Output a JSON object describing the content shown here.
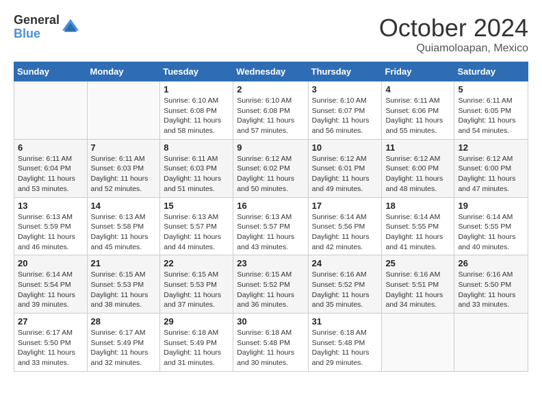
{
  "logo": {
    "general": "General",
    "blue": "Blue"
  },
  "header": {
    "month": "October 2024",
    "location": "Quiamoloapan, Mexico"
  },
  "weekdays": [
    "Sunday",
    "Monday",
    "Tuesday",
    "Wednesday",
    "Thursday",
    "Friday",
    "Saturday"
  ],
  "weeks": [
    [
      {
        "day": "",
        "info": ""
      },
      {
        "day": "",
        "info": ""
      },
      {
        "day": "1",
        "sunrise": "6:10 AM",
        "sunset": "6:08 PM",
        "daylight": "11 hours and 58 minutes."
      },
      {
        "day": "2",
        "sunrise": "6:10 AM",
        "sunset": "6:08 PM",
        "daylight": "11 hours and 57 minutes."
      },
      {
        "day": "3",
        "sunrise": "6:10 AM",
        "sunset": "6:07 PM",
        "daylight": "11 hours and 56 minutes."
      },
      {
        "day": "4",
        "sunrise": "6:11 AM",
        "sunset": "6:06 PM",
        "daylight": "11 hours and 55 minutes."
      },
      {
        "day": "5",
        "sunrise": "6:11 AM",
        "sunset": "6:05 PM",
        "daylight": "11 hours and 54 minutes."
      }
    ],
    [
      {
        "day": "6",
        "sunrise": "6:11 AM",
        "sunset": "6:04 PM",
        "daylight": "11 hours and 53 minutes."
      },
      {
        "day": "7",
        "sunrise": "6:11 AM",
        "sunset": "6:03 PM",
        "daylight": "11 hours and 52 minutes."
      },
      {
        "day": "8",
        "sunrise": "6:11 AM",
        "sunset": "6:03 PM",
        "daylight": "11 hours and 51 minutes."
      },
      {
        "day": "9",
        "sunrise": "6:12 AM",
        "sunset": "6:02 PM",
        "daylight": "11 hours and 50 minutes."
      },
      {
        "day": "10",
        "sunrise": "6:12 AM",
        "sunset": "6:01 PM",
        "daylight": "11 hours and 49 minutes."
      },
      {
        "day": "11",
        "sunrise": "6:12 AM",
        "sunset": "6:00 PM",
        "daylight": "11 hours and 48 minutes."
      },
      {
        "day": "12",
        "sunrise": "6:12 AM",
        "sunset": "6:00 PM",
        "daylight": "11 hours and 47 minutes."
      }
    ],
    [
      {
        "day": "13",
        "sunrise": "6:13 AM",
        "sunset": "5:59 PM",
        "daylight": "11 hours and 46 minutes."
      },
      {
        "day": "14",
        "sunrise": "6:13 AM",
        "sunset": "5:58 PM",
        "daylight": "11 hours and 45 minutes."
      },
      {
        "day": "15",
        "sunrise": "6:13 AM",
        "sunset": "5:57 PM",
        "daylight": "11 hours and 44 minutes."
      },
      {
        "day": "16",
        "sunrise": "6:13 AM",
        "sunset": "5:57 PM",
        "daylight": "11 hours and 43 minutes."
      },
      {
        "day": "17",
        "sunrise": "6:14 AM",
        "sunset": "5:56 PM",
        "daylight": "11 hours and 42 minutes."
      },
      {
        "day": "18",
        "sunrise": "6:14 AM",
        "sunset": "5:55 PM",
        "daylight": "11 hours and 41 minutes."
      },
      {
        "day": "19",
        "sunrise": "6:14 AM",
        "sunset": "5:55 PM",
        "daylight": "11 hours and 40 minutes."
      }
    ],
    [
      {
        "day": "20",
        "sunrise": "6:14 AM",
        "sunset": "5:54 PM",
        "daylight": "11 hours and 39 minutes."
      },
      {
        "day": "21",
        "sunrise": "6:15 AM",
        "sunset": "5:53 PM",
        "daylight": "11 hours and 38 minutes."
      },
      {
        "day": "22",
        "sunrise": "6:15 AM",
        "sunset": "5:53 PM",
        "daylight": "11 hours and 37 minutes."
      },
      {
        "day": "23",
        "sunrise": "6:15 AM",
        "sunset": "5:52 PM",
        "daylight": "11 hours and 36 minutes."
      },
      {
        "day": "24",
        "sunrise": "6:16 AM",
        "sunset": "5:52 PM",
        "daylight": "11 hours and 35 minutes."
      },
      {
        "day": "25",
        "sunrise": "6:16 AM",
        "sunset": "5:51 PM",
        "daylight": "11 hours and 34 minutes."
      },
      {
        "day": "26",
        "sunrise": "6:16 AM",
        "sunset": "5:50 PM",
        "daylight": "11 hours and 33 minutes."
      }
    ],
    [
      {
        "day": "27",
        "sunrise": "6:17 AM",
        "sunset": "5:50 PM",
        "daylight": "11 hours and 33 minutes."
      },
      {
        "day": "28",
        "sunrise": "6:17 AM",
        "sunset": "5:49 PM",
        "daylight": "11 hours and 32 minutes."
      },
      {
        "day": "29",
        "sunrise": "6:18 AM",
        "sunset": "5:49 PM",
        "daylight": "11 hours and 31 minutes."
      },
      {
        "day": "30",
        "sunrise": "6:18 AM",
        "sunset": "5:48 PM",
        "daylight": "11 hours and 30 minutes."
      },
      {
        "day": "31",
        "sunrise": "6:18 AM",
        "sunset": "5:48 PM",
        "daylight": "11 hours and 29 minutes."
      },
      {
        "day": "",
        "info": ""
      },
      {
        "day": "",
        "info": ""
      }
    ]
  ]
}
